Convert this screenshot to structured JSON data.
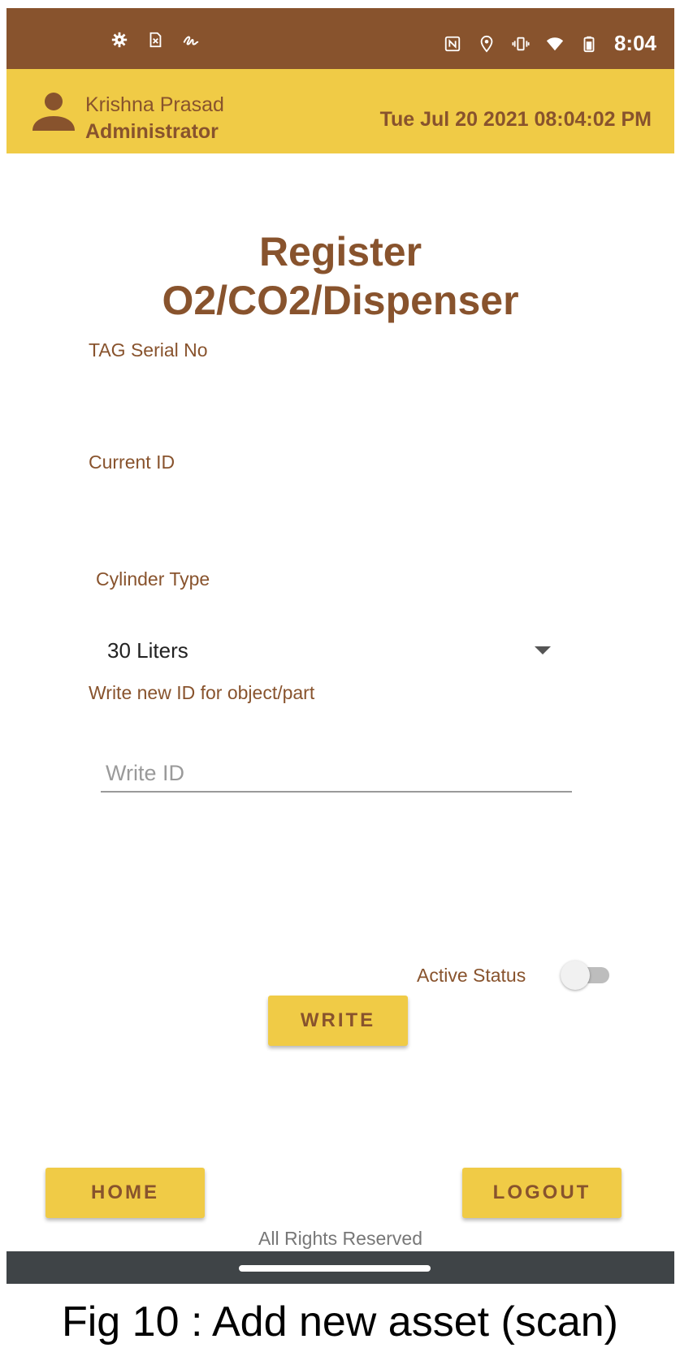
{
  "status_bar": {
    "time": "8:04",
    "left_icons": [
      "settings-icon",
      "sim-card-icon",
      "signature-icon"
    ],
    "right_icons": [
      "nfc-icon",
      "location-icon",
      "vibrate-icon",
      "wifi-icon",
      "battery-icon"
    ]
  },
  "header": {
    "user_name": "Krishna Prasad",
    "user_role": "Administrator",
    "datetime": "Tue Jul 20 2021 08:04:02 PM"
  },
  "page": {
    "title_line1": "Register",
    "title_line2": "O2/CO2/Dispenser"
  },
  "form": {
    "tag_serial_label": "TAG Serial No",
    "current_id_label": "Current ID",
    "cylinder_type_label": "Cylinder Type",
    "cylinder_type_value": "30 Liters",
    "write_new_id_label": "Write new ID for object/part",
    "write_id_placeholder": "Write ID",
    "active_status_label": "Active Status",
    "active_status_on": false,
    "write_button": "WRITE"
  },
  "footer": {
    "home_button": "HOME",
    "logout_button": "LOGOUT",
    "rights_text": "All Rights Reserved"
  },
  "caption": "Fig 10 : Add new asset (scan)",
  "colors": {
    "brown": "#88532d",
    "yellow": "#f0cb46",
    "nav_bar": "#3f4447"
  }
}
